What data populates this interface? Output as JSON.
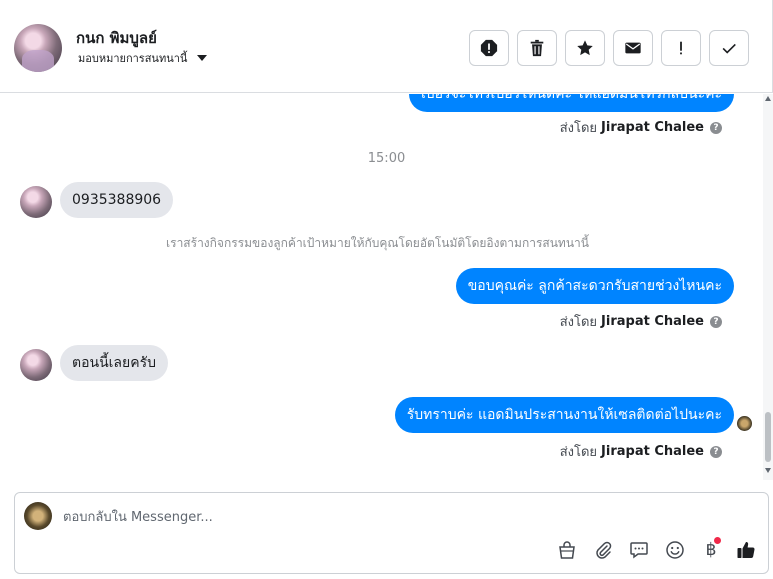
{
  "header": {
    "contact_name": "กนก พิมบูลย์",
    "assign_label": "มอบหมายการสนทนานี้",
    "actions": [
      {
        "name": "report-icon",
        "label": "Report"
      },
      {
        "name": "trash-icon",
        "label": "Delete"
      },
      {
        "name": "star-icon",
        "label": "Star"
      },
      {
        "name": "envelope-icon",
        "label": "Mark unread"
      },
      {
        "name": "exclamation-icon",
        "label": "Follow up"
      },
      {
        "name": "check-icon",
        "label": "Done"
      }
    ]
  },
  "messages": {
    "top_partial_text": "เบอร์จะโทรเบอร์ไหนดีคะ ให้แอดมินโทรกลับนะคะ",
    "sent_by_prefix": "ส่งโดย",
    "sent_by_name": "Jirapat Chalee",
    "help_glyph": "?",
    "timestamp": "15:00",
    "incoming_1": "0935388906",
    "system_note": "เราสร้างกิจกรรมของลูกค้าเป้าหมายให้กับคุณโดยอัตโนมัติโดยอิงตามการสนทนานี้",
    "outgoing_2": "ขอบคุณค่ะ ลูกค้าสะดวกรับสายช่วงไหนคะ",
    "incoming_2": "ตอนนี้เลยครับ",
    "outgoing_3": "รับทราบค่ะ แอดมินประสานงานให้เซลติดต่อไปนะคะ"
  },
  "composer": {
    "placeholder": "ตอบกลับใน Messenger...",
    "baht_glyph": "฿",
    "tools": [
      "bag-icon",
      "paperclip-icon",
      "chat-bubble-icon",
      "emoji-icon",
      "baht-icon",
      "thumbs-up-icon"
    ]
  },
  "colors": {
    "accent": "#0084ff",
    "incoming_bubble": "#e4e6eb",
    "notification_dot": "#f02849"
  }
}
